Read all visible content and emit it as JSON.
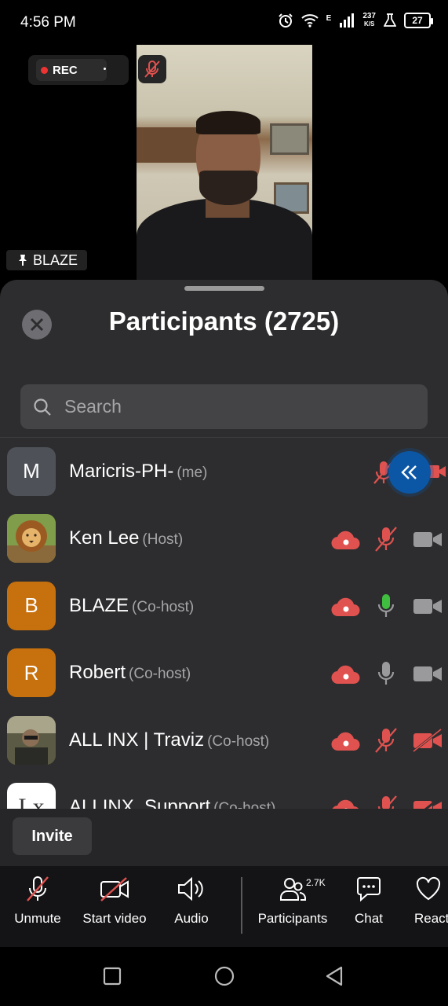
{
  "status_bar": {
    "time": "4:56 PM",
    "network": "E",
    "speed_top": "237",
    "speed_bottom": "K/S",
    "battery": "27"
  },
  "meeting": {
    "rec_label": "REC",
    "active_speaker": "BLAZE"
  },
  "participants_panel": {
    "title": "Participants (2725)",
    "search_placeholder": "Search",
    "participants": [
      {
        "name": "Maricris-PH-",
        "role": "(me)",
        "avatar_letter": "M",
        "avatar_color": "#4e5258",
        "mic": "muted",
        "video": "off"
      },
      {
        "name": "Ken Lee",
        "role": "(Host)",
        "avatar_letter": "",
        "avatar_color": "#c78b3a",
        "mic": "muted",
        "video": "on"
      },
      {
        "name": "BLAZE",
        "role": "(Co-host)",
        "avatar_letter": "B",
        "avatar_color": "#c7700e",
        "mic": "speaking",
        "video": "on"
      },
      {
        "name": "Robert",
        "role": "(Co-host)",
        "avatar_letter": "R",
        "avatar_color": "#c7700e",
        "mic": "unmuted",
        "video": "on"
      },
      {
        "name": "ALL INX | Traviz",
        "role": "(Co-host)",
        "avatar_letter": "",
        "avatar_color": "#6b5a3a",
        "mic": "muted",
        "video": "off"
      },
      {
        "name": "ALLINX_Support",
        "role": "(Co-host)",
        "avatar_letter": "Lx",
        "avatar_color": "#ffffff",
        "mic": "muted",
        "video": "off"
      }
    ],
    "invite_label": "Invite"
  },
  "toolbar": {
    "unmute": "Unmute",
    "start_video": "Start video",
    "audio": "Audio",
    "participants": "Participants",
    "participants_count": "2.7K",
    "chat": "Chat",
    "react": "React"
  },
  "colors": {
    "muted_red": "#e0524f",
    "speaking_green": "#3fbe3f",
    "accent_blue": "#0b57a5"
  }
}
